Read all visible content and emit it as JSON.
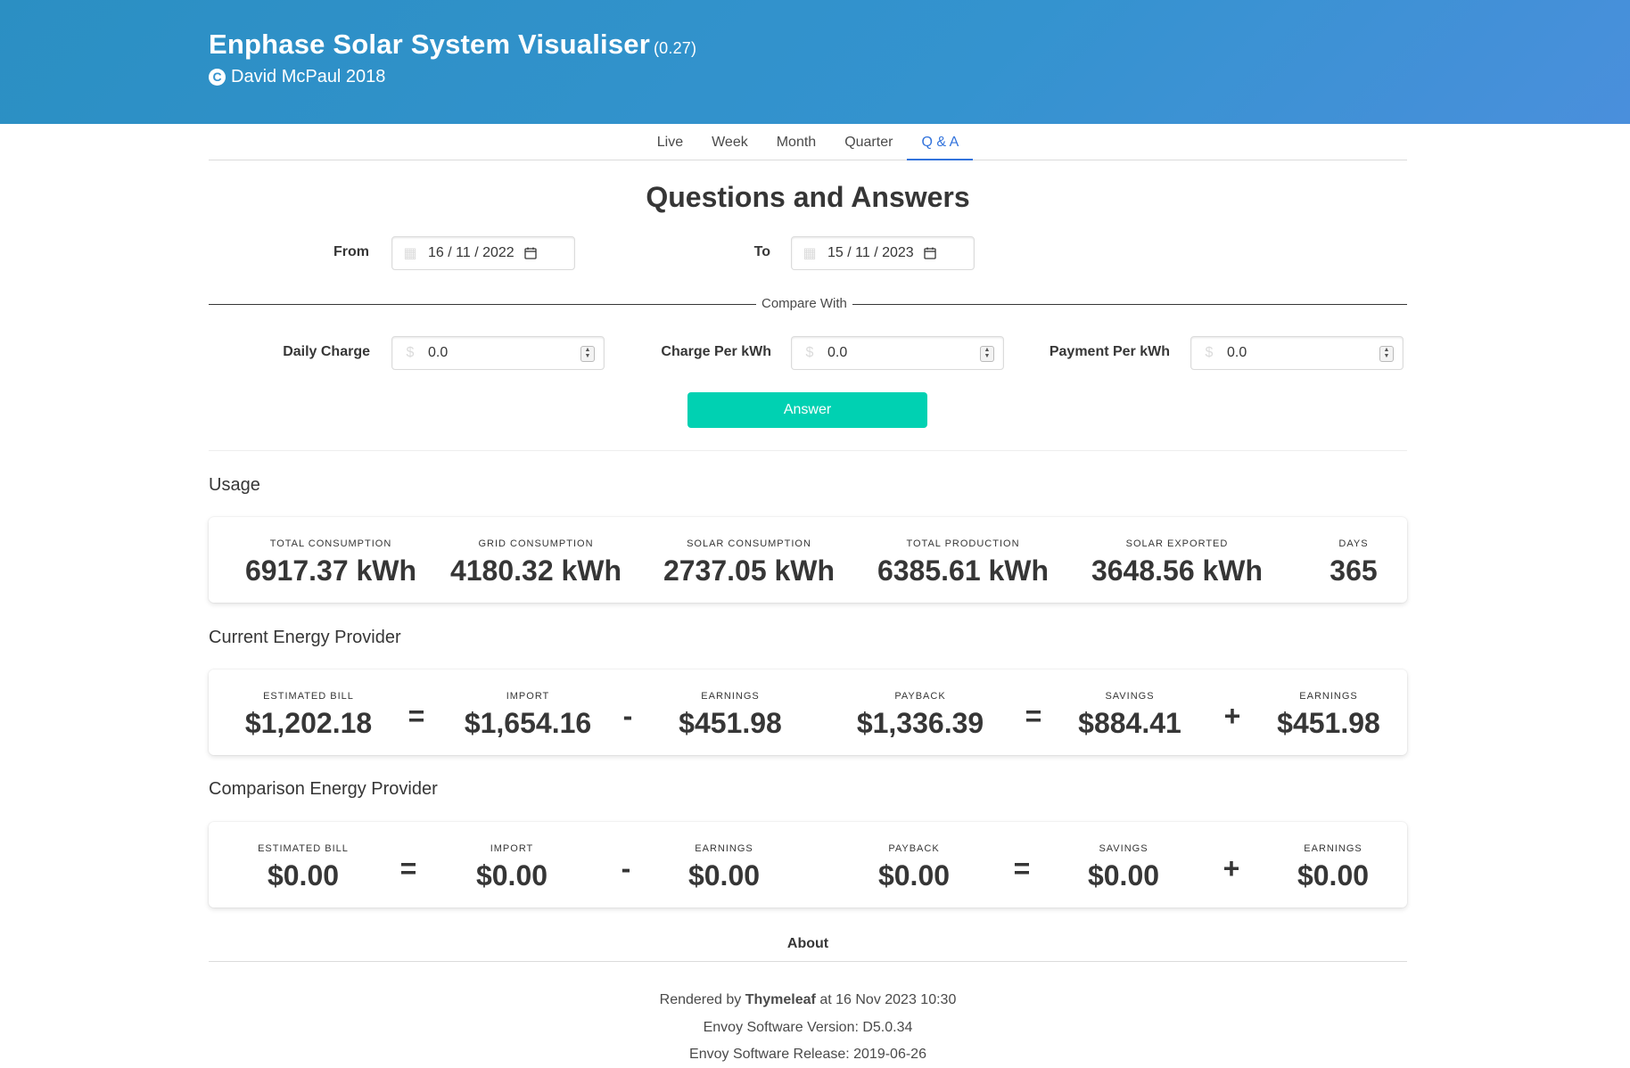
{
  "header": {
    "title": "Enphase Solar System Visualiser",
    "version": "(0.27)",
    "copyright_symbol": "C",
    "author": "David McPaul 2018"
  },
  "tabs": [
    {
      "label": "Live"
    },
    {
      "label": "Week"
    },
    {
      "label": "Month"
    },
    {
      "label": "Quarter"
    },
    {
      "label": "Q & A",
      "active": true
    }
  ],
  "page_title": "Questions and Answers",
  "form": {
    "from_label": "From",
    "from_value": "16 / 11 / 2022",
    "to_label": "To",
    "to_value": "15 / 11 / 2023",
    "compare_with": "Compare With",
    "daily_charge_label": "Daily Charge",
    "daily_charge_value": "0.0",
    "charge_per_kwh_label": "Charge Per kWh",
    "charge_per_kwh_value": "0.0",
    "payment_per_kwh_label": "Payment Per kWh",
    "payment_per_kwh_value": "0.0",
    "currency_symbol": "$",
    "answer_button": "Answer"
  },
  "usage": {
    "title": "Usage",
    "items": [
      {
        "heading": "Total Consumption",
        "value": "6917.37 kWh"
      },
      {
        "heading": "Grid Consumption",
        "value": "4180.32 kWh"
      },
      {
        "heading": "Solar Consumption",
        "value": "2737.05 kWh"
      },
      {
        "heading": "Total Production",
        "value": "6385.61 kWh"
      },
      {
        "heading": "Solar Exported",
        "value": "3648.56 kWh"
      },
      {
        "heading": "Days",
        "value": "365"
      }
    ]
  },
  "current": {
    "title": "Current Energy Provider",
    "estimated_bill": {
      "heading": "Estimated Bill",
      "value": "$1,202.18"
    },
    "import": {
      "heading": "Import",
      "value": "$1,654.16"
    },
    "earnings1": {
      "heading": "Earnings",
      "value": "$451.98"
    },
    "payback": {
      "heading": "Payback",
      "value": "$1,336.39"
    },
    "savings": {
      "heading": "Savings",
      "value": "$884.41"
    },
    "earnings2": {
      "heading": "Earnings",
      "value": "$451.98"
    }
  },
  "comparison": {
    "title": "Comparison Energy Provider",
    "estimated_bill": {
      "heading": "Estimated Bill",
      "value": "$0.00"
    },
    "import": {
      "heading": "Import",
      "value": "$0.00"
    },
    "earnings1": {
      "heading": "Earnings",
      "value": "$0.00"
    },
    "payback": {
      "heading": "Payback",
      "value": "$0.00"
    },
    "savings": {
      "heading": "Savings",
      "value": "$0.00"
    },
    "earnings2": {
      "heading": "Earnings",
      "value": "$0.00"
    }
  },
  "operators": {
    "equals": "=",
    "minus": "-",
    "plus": "+"
  },
  "footer": {
    "about": "About",
    "rendered_prefix": "Rendered by",
    "rendered_by": "Thymeleaf",
    "rendered_suffix": "at 16 Nov 2023 10:30",
    "envoy_version": "Envoy Software Version: D5.0.34",
    "envoy_release": "Envoy Software Release: 2019-06-26"
  }
}
